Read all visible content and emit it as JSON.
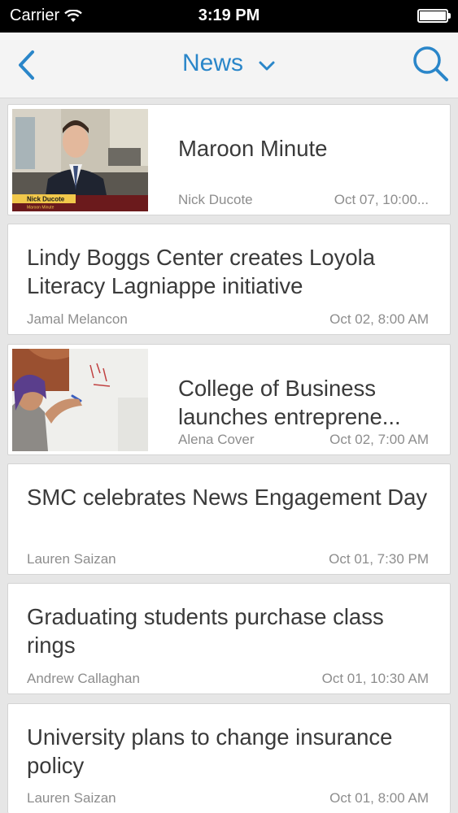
{
  "status_bar": {
    "carrier": "Carrier",
    "time": "3:19 PM"
  },
  "nav": {
    "title": "News",
    "back_icon": "chevron-left-icon",
    "dropdown_icon": "chevron-down-icon",
    "search_icon": "search-icon",
    "accent_color": "#2a86c9"
  },
  "articles": [
    {
      "title": "Maroon Minute",
      "author": "Nick Ducote",
      "date": "Oct 07, 10:00...",
      "has_image": true,
      "image_caption": "Nick Ducote",
      "image_subcaption": "Maroon Minute"
    },
    {
      "title": "Lindy Boggs Center creates Loyola Literacy Lagniappe initiative",
      "author": "Jamal Melancon",
      "date": "Oct 02, 8:00 AM",
      "has_image": false
    },
    {
      "title": "College of Business launches entreprene...",
      "author": "Alena Cover",
      "date": "Oct 02, 7:00 AM",
      "has_image": true
    },
    {
      "title": "SMC celebrates News Engagement Day",
      "author": "Lauren Saizan",
      "date": "Oct 01, 7:30 PM",
      "has_image": false
    },
    {
      "title": "Graduating students purchase class rings",
      "author": "Andrew Callaghan",
      "date": "Oct 01, 10:30 AM",
      "has_image": false
    },
    {
      "title": "University plans to change insurance policy",
      "author": "Lauren Saizan",
      "date": "Oct 01, 8:00 AM",
      "has_image": false
    }
  ]
}
